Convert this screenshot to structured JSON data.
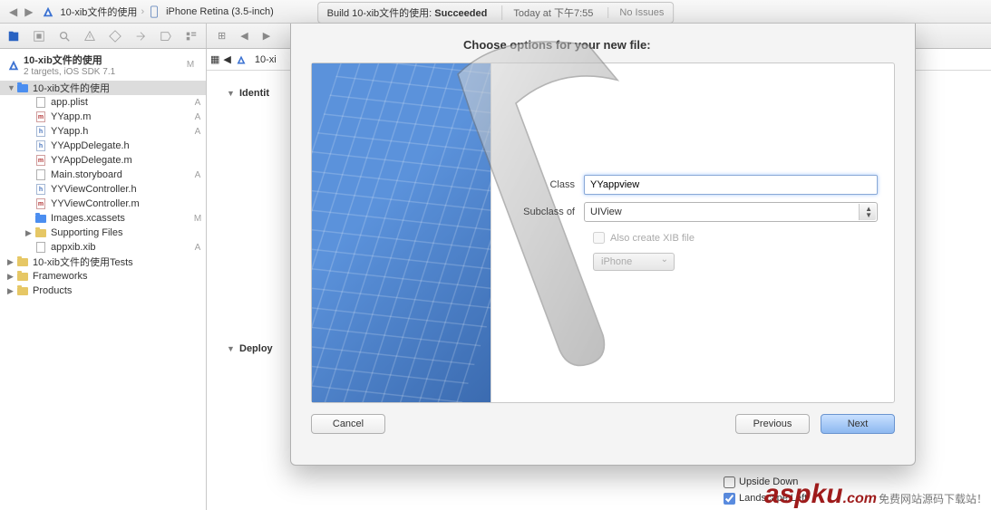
{
  "toolbar": {
    "breadcrumb": {
      "project": "10-xib文件的使用",
      "device": "iPhone Retina (3.5-inch)"
    },
    "status": {
      "build": "Build 10-xib文件的使用:",
      "result": "Succeeded",
      "time": "Today at 下午7:55",
      "issues": "No Issues"
    }
  },
  "project": {
    "title": "10-xib文件的使用",
    "subtitle": "2 targets, iOS SDK 7.1",
    "flag": "M"
  },
  "tree": [
    {
      "level": 1,
      "disclose": "▼",
      "icon": "folder-blue",
      "label": "10-xib文件的使用",
      "flag": "",
      "selected": true
    },
    {
      "level": 2,
      "disclose": "",
      "icon": "file",
      "label": "app.plist",
      "flag": "A"
    },
    {
      "level": 2,
      "disclose": "",
      "icon": "file-m",
      "label": "YYapp.m",
      "flag": "A"
    },
    {
      "level": 2,
      "disclose": "",
      "icon": "file-h",
      "label": "YYapp.h",
      "flag": "A"
    },
    {
      "level": 2,
      "disclose": "",
      "icon": "file-h",
      "label": "YYAppDelegate.h",
      "flag": ""
    },
    {
      "level": 2,
      "disclose": "",
      "icon": "file-m",
      "label": "YYAppDelegate.m",
      "flag": ""
    },
    {
      "level": 2,
      "disclose": "",
      "icon": "file",
      "label": "Main.storyboard",
      "flag": "A"
    },
    {
      "level": 2,
      "disclose": "",
      "icon": "file-h",
      "label": "YYViewController.h",
      "flag": ""
    },
    {
      "level": 2,
      "disclose": "",
      "icon": "file-m",
      "label": "YYViewController.m",
      "flag": ""
    },
    {
      "level": 2,
      "disclose": "",
      "icon": "folder-blue",
      "label": "Images.xcassets",
      "flag": "M"
    },
    {
      "level": 2,
      "disclose": "▶",
      "icon": "folder-yellow",
      "label": "Supporting Files",
      "flag": ""
    },
    {
      "level": 3,
      "disclose": "",
      "icon": "file",
      "label": "appxib.xib",
      "flag": "A"
    },
    {
      "level": 1,
      "disclose": "▶",
      "icon": "folder-yellow",
      "label": "10-xib文件的使用Tests",
      "flag": ""
    },
    {
      "level": 1,
      "disclose": "▶",
      "icon": "folder-yellow",
      "label": "Frameworks",
      "flag": ""
    },
    {
      "level": 1,
      "disclose": "▶",
      "icon": "folder-yellow",
      "label": "Products",
      "flag": ""
    }
  ],
  "editor_tab": {
    "label": "10-xi"
  },
  "outline": {
    "item1": "Identit",
    "item2": "Deploy"
  },
  "orientation": {
    "upside": "Upside Down",
    "left": "Landscape Left"
  },
  "sheet": {
    "title": "Choose options for your new file:",
    "class_label": "Class",
    "class_value": "YYappview",
    "subclass_label": "Subclass of",
    "subclass_value": "UIView",
    "also_xib_label": "Also create XIB file",
    "device_value": "iPhone",
    "cancel": "Cancel",
    "previous": "Previous",
    "next": "Next"
  },
  "watermark": {
    "brand": "aspku",
    "tld": ".com",
    "cn": "免费网站源码下载站！"
  }
}
